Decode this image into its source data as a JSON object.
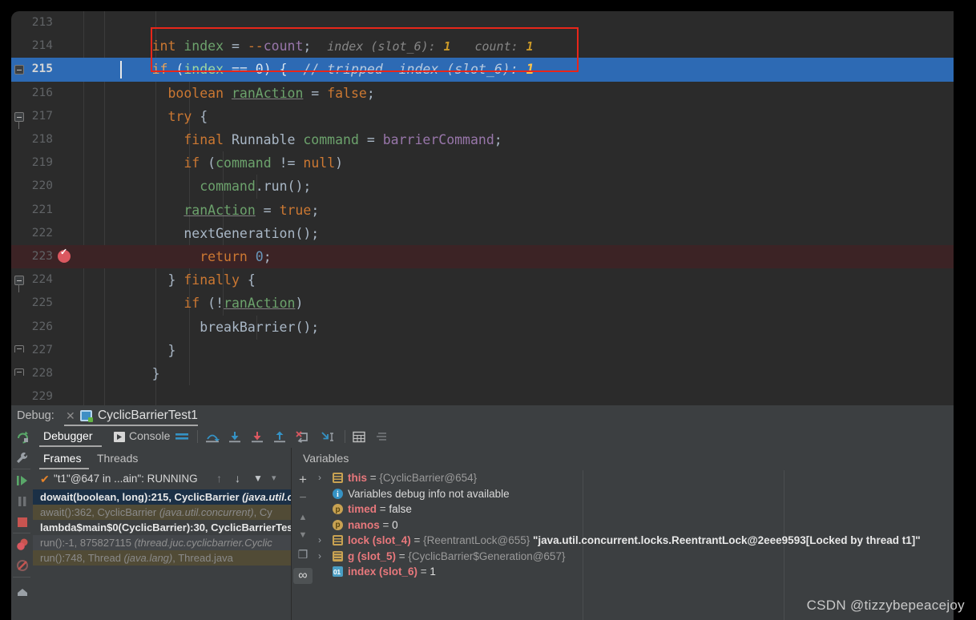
{
  "editor": {
    "lines": [
      {
        "num": "213",
        "tokens": []
      },
      {
        "num": "214",
        "code_parts": [
          "int",
          " ",
          "index",
          " = ",
          "--",
          "count",
          ";"
        ],
        "hint1": "index (slot_6):",
        "hint1val": "1",
        "hint2": "count:",
        "hint2val": "1"
      },
      {
        "num": "215",
        "code": "if (index == 0) {",
        "comment": "// tripped",
        "hint1": "index (slot_6):",
        "hint1val": "1"
      },
      {
        "num": "216",
        "code": "boolean ranAction = false;"
      },
      {
        "num": "217",
        "code": "try {"
      },
      {
        "num": "218",
        "code": "final Runnable command = barrierCommand;"
      },
      {
        "num": "219",
        "code": "if (command != null)"
      },
      {
        "num": "220",
        "code": "command.run();"
      },
      {
        "num": "221",
        "code": "ranAction = true;"
      },
      {
        "num": "222",
        "code": "nextGeneration();"
      },
      {
        "num": "223",
        "code": "return 0;"
      },
      {
        "num": "224",
        "code": "} finally {"
      },
      {
        "num": "225",
        "code": "if (!ranAction)"
      },
      {
        "num": "226",
        "code": "breakBarrier();"
      },
      {
        "num": "227",
        "code": "}"
      },
      {
        "num": "228",
        "code": "}"
      },
      {
        "num": "229",
        "code": ""
      }
    ],
    "line_numbers": [
      "213",
      "214",
      "215",
      "216",
      "217",
      "218",
      "219",
      "220",
      "221",
      "222",
      "223",
      "224",
      "225",
      "226",
      "227",
      "228",
      "229"
    ],
    "l214": {
      "kw_int": "int",
      "name": "index",
      "eq": " = ",
      "dec": "--",
      "count": "count",
      "semi": ";",
      "hint_index": "index (slot_6):",
      "hint_index_val": "1",
      "hint_count": "count:",
      "hint_count_val": "1"
    },
    "l215": {
      "kw_if": "if",
      "open": " (",
      "var": "index",
      "op": " == ",
      "zero": "0",
      "close": ") {",
      "comment": "// tripped",
      "hint_index": "index (slot_6):",
      "hint_index_val": "1"
    },
    "l216": {
      "kw": "boolean",
      "name": "ranAction",
      "rest": " = ",
      "val": "false",
      "semi": ";"
    },
    "l217": {
      "kw": "try",
      "rest": " {"
    },
    "l218": {
      "kw": "final",
      "type": " Runnable ",
      "name": "command",
      "eq": " = ",
      "field": "barrierCommand",
      "semi": ";"
    },
    "l219": {
      "kw": "if",
      "open": " (",
      "name": "command",
      "op": " != ",
      "nul": "null",
      "close": ")"
    },
    "l220": {
      "name": "command",
      "dot": ".",
      "call": "run",
      "rest": "();"
    },
    "l221": {
      "name": "ranAction",
      "eq": " = ",
      "val": "true",
      "semi": ";"
    },
    "l222": {
      "call": "nextGeneration",
      "rest": "();"
    },
    "l223": {
      "kw": "return",
      "val": " 0",
      "semi": ";"
    },
    "l224": {
      "text": "} ",
      "kw": "finally",
      "rest": " {"
    },
    "l225": {
      "kw": "if",
      "open": " (",
      "bang": "!",
      "name": "ranAction",
      "close": ")"
    },
    "l226": {
      "call": "breakBarrier",
      "rest": "();"
    },
    "l227": {
      "text": "}"
    },
    "l228": {
      "text": "}"
    }
  },
  "debug_header": {
    "label": "Debug:",
    "close_glyph": "✕",
    "tab_title": "CyclicBarrierTest1"
  },
  "left_toolbar": {
    "items": [
      {
        "name": "rerun-icon",
        "glyph": "↻"
      },
      {
        "name": "settings-wrench-icon",
        "glyph": "🔧"
      },
      {
        "name": "resume-program-icon",
        "glyph": "▶"
      },
      {
        "name": "pause-program-icon",
        "glyph": "❚❚"
      },
      {
        "name": "stop-icon",
        "glyph": "■"
      },
      {
        "name": "view-breakpoints-icon",
        "glyph": "●"
      },
      {
        "name": "mute-breakpoints-icon",
        "glyph": "⦸"
      },
      {
        "name": "layout-settings-icon",
        "glyph": "⌂"
      }
    ]
  },
  "tabs": {
    "debugger": "Debugger",
    "console": "Console",
    "toolbar_icons": [
      {
        "name": "trace-lines-icon"
      },
      {
        "name": "step-over-icon"
      },
      {
        "name": "step-into-icon"
      },
      {
        "name": "force-step-into-icon"
      },
      {
        "name": "step-out-icon"
      },
      {
        "name": "drop-frame-icon"
      },
      {
        "name": "run-to-cursor-icon"
      },
      {
        "name": "evaluate-expression-icon"
      },
      {
        "name": "settings-list-icon"
      }
    ]
  },
  "frames_panel": {
    "tab_frames": "Frames",
    "tab_threads": "Threads",
    "thread_selector": "\"t1\"@647 in ...ain\": RUNNING",
    "thread_check": "✔",
    "nav_up": "↑",
    "nav_down": "↓",
    "filter": "▼",
    "dropdown": "▾",
    "frames": [
      {
        "text": "dowait(boolean, long):215, CyclicBarrier ",
        "italic": "(java.util.c",
        "style": "sel"
      },
      {
        "text": "await():362, CyclicBarrier ",
        "italic": "(java.util.concurrent)",
        "tail": ", Cy",
        "style": "lib"
      },
      {
        "text": "lambda$main$0(CyclicBarrier):30, CyclicBarrierTes",
        "italic": "",
        "style": "app"
      },
      {
        "text": "run():-1, 875827115 ",
        "italic": "(thread.juc.cyclicbarrier.Cyclic",
        "style": "lib2"
      },
      {
        "text": "run():748, Thread ",
        "italic": "(java.lang)",
        "tail": ", Thread.java",
        "style": "lib"
      }
    ]
  },
  "vars_toolbar": {
    "add": "+",
    "remove": "−",
    "up": "▲",
    "down": "▼",
    "copy": "❐",
    "watches": "∞"
  },
  "variables_panel": {
    "header": "Variables",
    "rows": [
      {
        "arrow": "›",
        "icon": "list-icon",
        "name": "this",
        "eq": " = ",
        "ref": "{CyclicBarrier@654}",
        "str": ""
      },
      {
        "arrow": "",
        "icon": "info-icon",
        "info": "Variables debug info not available"
      },
      {
        "arrow": "",
        "icon": "param-icon",
        "name": "timed",
        "eq": " = ",
        "val": "false"
      },
      {
        "arrow": "",
        "icon": "param-icon",
        "name": "nanos",
        "eq": " = ",
        "val": "0"
      },
      {
        "arrow": "›",
        "icon": "list-icon",
        "name": "lock (slot_4)",
        "eq": " = ",
        "ref": "{ReentrantLock@655}",
        "str": "\"java.util.concurrent.locks.ReentrantLock@2eee9593[Locked by thread t1]\""
      },
      {
        "arrow": "›",
        "icon": "list-icon",
        "name": "g (slot_5)",
        "eq": " = ",
        "ref": "{CyclicBarrier$Generation@657}"
      },
      {
        "arrow": "",
        "icon": "primitive-icon",
        "name": "index (slot_6)",
        "eq": " = ",
        "val": "1"
      }
    ]
  },
  "watermark": "CSDN @tizzybepeacejoy",
  "colors": {
    "editor_bg": "#2b2b2b",
    "panel_bg": "#3c3f41",
    "selection_blue": "#2d6ab4",
    "breakpoint_line": "#3c2325",
    "red_box": "#e8261a",
    "keyword_orange": "#cc7832",
    "field_purple": "#9876aa",
    "number_blue": "#6897bb",
    "variable_red": "#e8787c"
  }
}
